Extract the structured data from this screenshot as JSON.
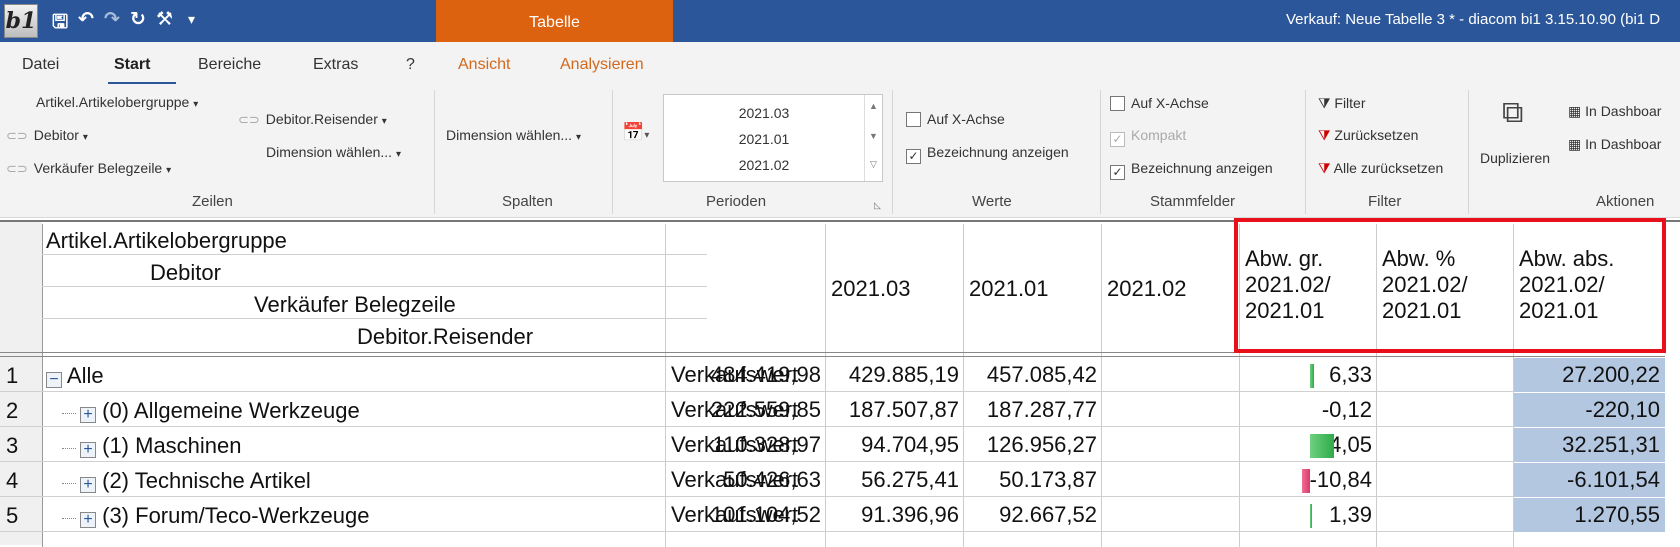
{
  "titlebar": {
    "logo": "b1",
    "context_tab": "Tabelle",
    "window_title": "Verkauf: Neue Tabelle 3 * - diacom bi1 3.15.10.90 (bi1 D"
  },
  "menu": {
    "tabs": [
      "Datei",
      "Start",
      "Bereiche",
      "Extras",
      "?",
      "Ansicht",
      "Analysieren"
    ],
    "active": "Start"
  },
  "ribbon": {
    "zeilen": {
      "items": [
        "Artikel.Artikelobergruppe",
        "Debitor",
        "Verkäufer Belegzeile",
        "Debitor.Reisender",
        "Dimension wählen..."
      ],
      "group": "Zeilen"
    },
    "spalten": {
      "dimension": "Dimension wählen...",
      "group": "Spalten"
    },
    "perioden": {
      "items": [
        "2021.03",
        "2021.01",
        "2021.02"
      ],
      "group": "Perioden"
    },
    "werte": {
      "items": [
        "Auf X-Achse",
        "Bezeichnung anzeigen"
      ],
      "checked": [
        false,
        true
      ],
      "group": "Werte"
    },
    "stammfelder": {
      "items": [
        "Auf X-Achse",
        "Kompakt",
        "Bezeichnung anzeigen"
      ],
      "checked": [
        false,
        true,
        true
      ],
      "group": "Stammfelder"
    },
    "filter": {
      "items": [
        "Filter",
        "Zurücksetzen",
        "Alle zurücksetzen"
      ],
      "group": "Filter"
    },
    "aktionen": {
      "items": [
        "Duplizieren",
        "In Dashboar",
        "In Dashboar"
      ],
      "group": "Aktionen"
    }
  },
  "grid": {
    "row_headers": [
      "Artikel.Artikelobergruppe",
      "Debitor",
      "Verkäufer Belegzeile",
      "Debitor.Reisender"
    ],
    "columns": [
      "2021.03",
      "2021.01",
      "2021.02"
    ],
    "calc_columns": [
      "Abw. gr.\n2021.02/\n2021.01",
      "Abw. %\n2021.02/\n2021.01",
      "Abw. abs.\n2021.02/\n2021.01"
    ],
    "rows": [
      {
        "num": "1",
        "label": "Alle",
        "measure": "Verkaufswert",
        "v1": "484.419,98",
        "v2": "429.885,19",
        "v3": "457.085,42",
        "pct": "6,33",
        "abs": "27.200,22",
        "bar": 6.33
      },
      {
        "num": "2",
        "label": "(0) Allgemeine Werkzeuge",
        "measure": "Verkaufswert",
        "v1": "222.559,85",
        "v2": "187.507,87",
        "v3": "187.287,77",
        "pct": "-0,12",
        "abs": "-220,10",
        "bar": -0.12
      },
      {
        "num": "3",
        "label": "(1) Maschinen",
        "measure": "Verkaufswert",
        "v1": "110.328,97",
        "v2": "94.704,95",
        "v3": "126.956,27",
        "pct": "34,05",
        "abs": "32.251,31",
        "bar": 34.05
      },
      {
        "num": "4",
        "label": "(2) Technische Artikel",
        "measure": "Verkaufswert",
        "v1": "50.426,63",
        "v2": "56.275,41",
        "v3": "50.173,87",
        "pct": "-10,84",
        "abs": "-6.101,54",
        "bar": -10.84
      },
      {
        "num": "5",
        "label": "(3) Forum/Teco-Werkzeuge",
        "measure": "Verkaufswert",
        "v1": "101.104,52",
        "v2": "91.396,96",
        "v3": "92.667,52",
        "pct": "1,39",
        "abs": "1.270,55",
        "bar": 1.39
      }
    ]
  }
}
